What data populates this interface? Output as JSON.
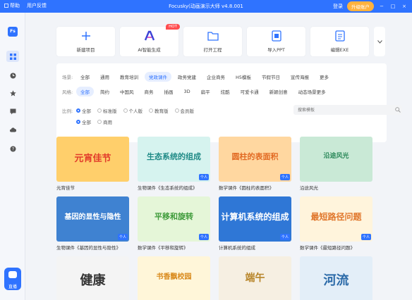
{
  "titlebar": {
    "menu": [
      "帮助",
      "用户反馈"
    ],
    "title": "Focusky(动画演示大师 v4.8.001",
    "login": "登录",
    "upgrade": "升级账户",
    "controls": [
      "−",
      "□",
      "×"
    ]
  },
  "sidebar": {
    "logo": "Fs",
    "items": [
      "home-icon",
      "clock-icon",
      "star-icon",
      "chat-icon",
      "cloud-icon",
      "help-icon"
    ],
    "live_label": "直播"
  },
  "actions": [
    {
      "label": "新建项目",
      "icon": "plus-icon"
    },
    {
      "label": "AI智能生成",
      "icon": "ai-icon",
      "badge": "HOT"
    },
    {
      "label": "打开工程",
      "icon": "folder-icon"
    },
    {
      "label": "导入PPT",
      "icon": "ppt-icon"
    },
    {
      "label": "编辑EXE",
      "icon": "exe-icon"
    }
  ],
  "filters": {
    "scene": {
      "label": "场景:",
      "options": [
        "全部",
        "通用",
        "教育培训",
        "党政课件",
        "政务党建",
        "企业商务",
        "H5模板",
        "节假节日",
        "宣传海报",
        "更多"
      ],
      "active": 4
    },
    "style": {
      "label": "风格:",
      "options": [
        "全部",
        "简约",
        "中国风",
        "商务",
        "插画",
        "3D",
        "扁平",
        "炫酷",
        "可爱卡通",
        "新颖创意",
        "动态场景更多"
      ],
      "active": 0
    },
    "ratio": {
      "label": "比例:",
      "options": [
        "全部",
        "标准版",
        "个人版",
        "教育版",
        "会员版"
      ],
      "active": 0
    },
    "price": {
      "options": [
        "全部",
        "商用"
      ],
      "active": 0
    },
    "search_placeholder": "搜索模板"
  },
  "templates": [
    {
      "title": "元宵佳节",
      "thumb_text": "元宵佳节",
      "bg": "#ffcf6b",
      "fg": "#e23c2a",
      "tag": ""
    },
    {
      "title": "生物课件《生态系统的组成》",
      "thumb_text": "生态系统的组成",
      "bg": "#d6f3ef",
      "fg": "#1f8a86",
      "tag": "个人"
    },
    {
      "title": "数学课件《圆柱的表面积》",
      "thumb_text": "圆柱的表面积",
      "bg": "#ffd7a0",
      "fg": "#e26a23",
      "tag": "个人"
    },
    {
      "title": "沿途风光",
      "thumb_text": "沿途风光",
      "bg": "#c9e9d6",
      "fg": "#2e8a5c",
      "tag": ""
    },
    {
      "title": "生物课件《基因的显性与隐性》",
      "thumb_text": "基因的显性与隐性",
      "bg": "#3f82d1",
      "fg": "#ffffff",
      "tag": "个人"
    },
    {
      "title": "数学课件《平移和旋转》",
      "thumb_text": "平移和旋转",
      "bg": "#e5f6d8",
      "fg": "#3e9b3a",
      "tag": "个人"
    },
    {
      "title": "计算机系统的组成",
      "thumb_text": "计算机系统的组成",
      "bg": "#2f77d6",
      "fg": "#ffffff",
      "tag": "个人"
    },
    {
      "title": "数学课件《最短路径问题》",
      "thumb_text": "最短路径问题",
      "bg": "#fff4dc",
      "fg": "#e0762b",
      "tag": "个人"
    },
    {
      "title": "",
      "thumb_text": "健康",
      "bg": "#f4f4f4",
      "fg": "#333333",
      "tag": ""
    },
    {
      "title": "",
      "thumb_text": "书香飘校园",
      "bg": "#fff6d9",
      "fg": "#d98a1c",
      "tag": ""
    },
    {
      "title": "",
      "thumb_text": "端午",
      "bg": "#f6efe2",
      "fg": "#b8862b",
      "tag": ""
    },
    {
      "title": "",
      "thumb_text": "河流",
      "bg": "#e3eef8",
      "fg": "#2b6aa8",
      "tag": ""
    }
  ]
}
